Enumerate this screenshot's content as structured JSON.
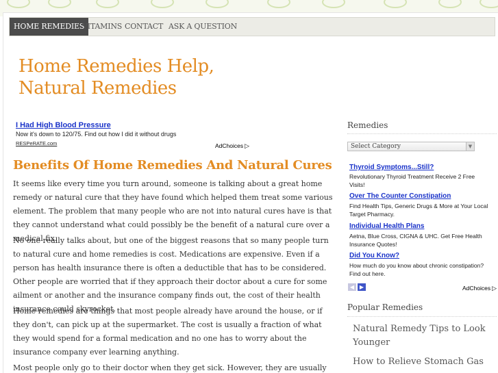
{
  "nav": {
    "items": [
      {
        "label": "HOME REMEDIES",
        "active": true
      },
      {
        "label": "VITAMINS",
        "active": false
      },
      {
        "label": "CONTACT",
        "active": false
      },
      {
        "label": "ASK A QUESTION",
        "active": false
      }
    ]
  },
  "site": {
    "title_line1": "Home Remedies Help,",
    "title_line2": "Natural Remedies"
  },
  "top_ad": {
    "title": "I Had High Blood Pressure",
    "text": "Now it's down to 120/75. Find out how I did it without drugs",
    "url": "RESPeRATE.com",
    "adchoices": "AdChoices"
  },
  "post": {
    "title": "Benefits Of Home Remedies And Natural Cures",
    "paragraphs": [
      "It seems like every time you turn around, someone is talking about a great home remedy or natural cure that they have found which helped them treat some various element. The problem that many people who are not into natural cures have is that they cannot understand what could possibly be the benefit of a natural cure over a medical fix.",
      "No one really talks about, but one of the biggest reasons that so many people turn to natural cure and home remedies is cost. Medications are expensive. Even if a person has health insurance there is often a deductible that has to be considered. Other people are worried that if they approach their doctor about a cure for some ailment or another and the insurance company finds out, the cost of their health insurance could skyrocket.",
      "Home remedies are things that most people already have around the house, or if they don't, can pick up at the supermarket. The cost is usually a fraction of what they would spend for a formal medication and no one has to worry about the insurance company ever learning anything.",
      "Most people only go to their doctor when they get sick. However, they are usually willing to"
    ]
  },
  "sidebar": {
    "remedies_heading": "Remedies",
    "select_value": "Select Category",
    "ads": [
      {
        "title": "Thyroid Symptoms...Still?",
        "line1": "Revolutionary Thyroid Treatment Receive 2 Free",
        "line2": "Visits!"
      },
      {
        "title": "Over The Counter Constipation",
        "line1": "Find Health Tips, Generic Drugs & More at Your Local",
        "line2": "Target Pharmacy."
      },
      {
        "title": "Individual Health Plans",
        "line1": "Aetna, Blue Cross, CIGNA & UHC. Get Free Health",
        "line2": "Insurance Quotes!"
      },
      {
        "title": "Did You Know?",
        "line1": "How much do you know about chronic constipation?",
        "line2": "Find out here."
      }
    ],
    "adchoices": "AdChoices",
    "popular_heading": "Popular Remedies",
    "popular": [
      "Natural Remedy Tips to Look Younger",
      "How to Relieve Stomach Gas"
    ]
  },
  "colors": {
    "accent": "#e38c23",
    "link": "#1a33c9",
    "nav_active": "#4b4b4b"
  }
}
